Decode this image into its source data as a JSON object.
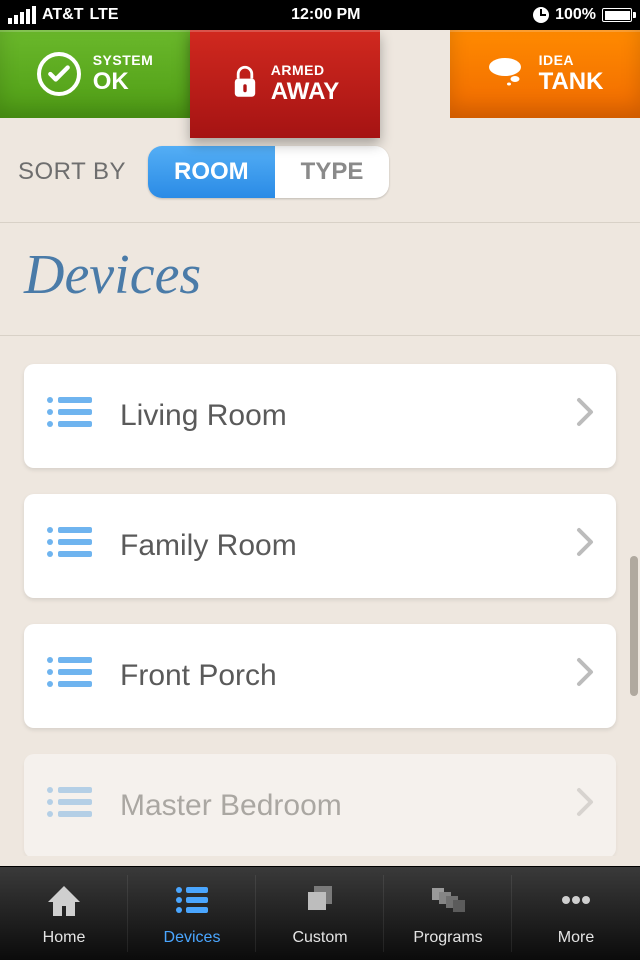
{
  "status_bar": {
    "carrier": "AT&T",
    "network": "LTE",
    "time": "12:00 PM",
    "battery_pct": "100%"
  },
  "top_cards": {
    "system": {
      "line1": "SYSTEM",
      "line2": "OK"
    },
    "armed": {
      "line1": "ARMED",
      "line2": "AWAY"
    },
    "idea": {
      "line1": "IDEA",
      "line2": "TANK"
    }
  },
  "sort": {
    "label": "SORT BY",
    "options": {
      "room": "ROOM",
      "type": "TYPE"
    }
  },
  "page_title": "Devices",
  "rooms": [
    {
      "label": "Living Room"
    },
    {
      "label": "Family Room"
    },
    {
      "label": "Front Porch"
    },
    {
      "label": "Master Bedroom"
    }
  ],
  "tabs": {
    "home": "Home",
    "devices": "Devices",
    "custom": "Custom",
    "programs": "Programs",
    "more": "More"
  }
}
